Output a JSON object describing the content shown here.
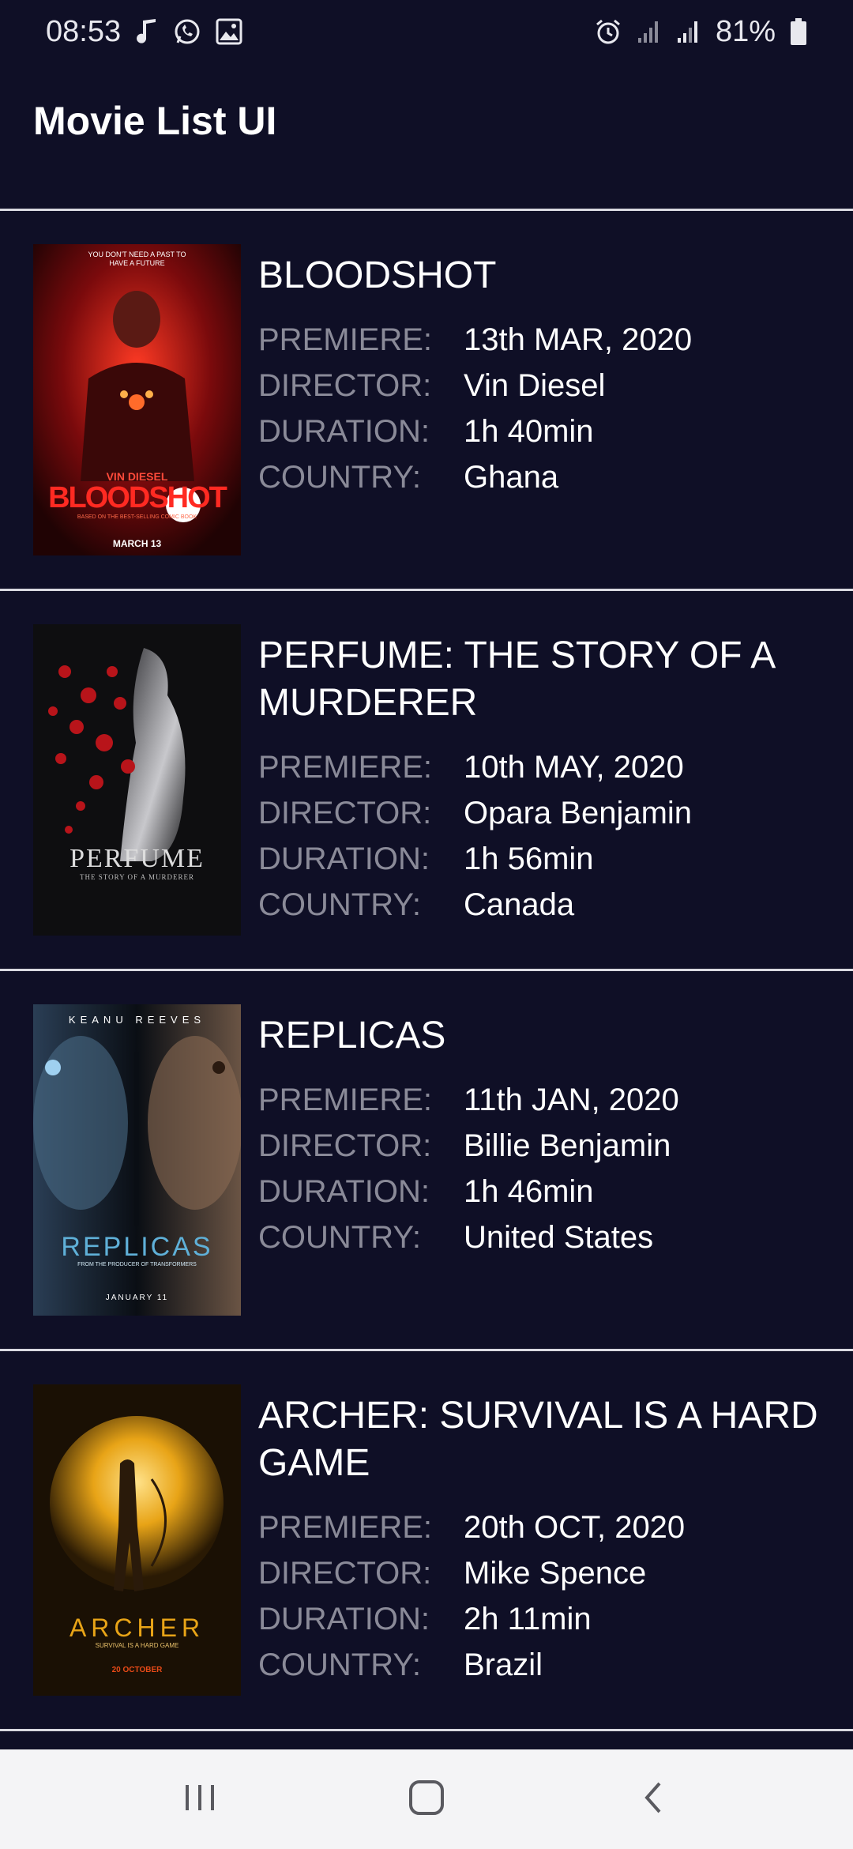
{
  "status_bar": {
    "time": "08:53",
    "battery": "81%",
    "left_icons": [
      "music-note-icon",
      "whatsapp-icon",
      "gallery-icon"
    ],
    "right_icons": [
      "alarm-icon",
      "signal-icon",
      "signal-icon",
      "battery-icon"
    ]
  },
  "app": {
    "title": "Movie List UI"
  },
  "labels": {
    "premiere": "PREMIERE:",
    "director": "DIRECTOR:",
    "duration": "DURATION:",
    "country": "COUNTRY:"
  },
  "movies": [
    {
      "title": "BLOODSHOT",
      "premiere": "13th MAR, 2020",
      "director": "Vin Diesel",
      "duration": "1h 40min",
      "country": "Ghana",
      "poster": {
        "tagline": "YOU DON'T NEED A PAST TO HAVE A FUTURE",
        "actor": "VIN DIESEL",
        "name": "BLOODSHOT",
        "subline": "BASED ON THE BEST-SELLING COMIC BOOK",
        "date": "MARCH 13",
        "colors": {
          "bg": "#3a0608",
          "accent": "#e0241f"
        }
      }
    },
    {
      "title": "PERFUME: THE STORY OF A MURDERER",
      "premiere": "10th MAY, 2020",
      "director": "Opara Benjamin",
      "duration": "1h 56min",
      "country": "Canada",
      "poster": {
        "name": "PERFUME",
        "subline": "THE STORY OF A MURDERER",
        "colors": {
          "bg": "#1a1a1c",
          "accent": "#b8141a"
        }
      }
    },
    {
      "title": "REPLICAS",
      "premiere": "11th JAN, 2020",
      "director": "Billie Benjamin",
      "duration": "1h 46min",
      "country": "United States",
      "poster": {
        "actor": "KEANU REEVES",
        "name": "REPLICAS",
        "subline": "FROM THE PRODUCER OF TRANSFORMERS",
        "date": "JANUARY 11",
        "colors": {
          "bg": "#1b2430",
          "accent": "#5fb0d8"
        }
      }
    },
    {
      "title": "ARCHER: SURVIVAL IS A HARD GAME",
      "premiere": "20th OCT, 2020",
      "director": "Mike Spence",
      "duration": "2h 11min",
      "country": "Brazil",
      "poster": {
        "name": "ARCHER",
        "subline": "SURVIVAL IS A HARD GAME",
        "date": "20 OCTOBER",
        "colors": {
          "bg": "#2a1a04",
          "accent": "#e8a417"
        }
      }
    }
  ],
  "nav_bar": {
    "icons": [
      "recents-icon",
      "home-icon",
      "back-icon"
    ]
  }
}
